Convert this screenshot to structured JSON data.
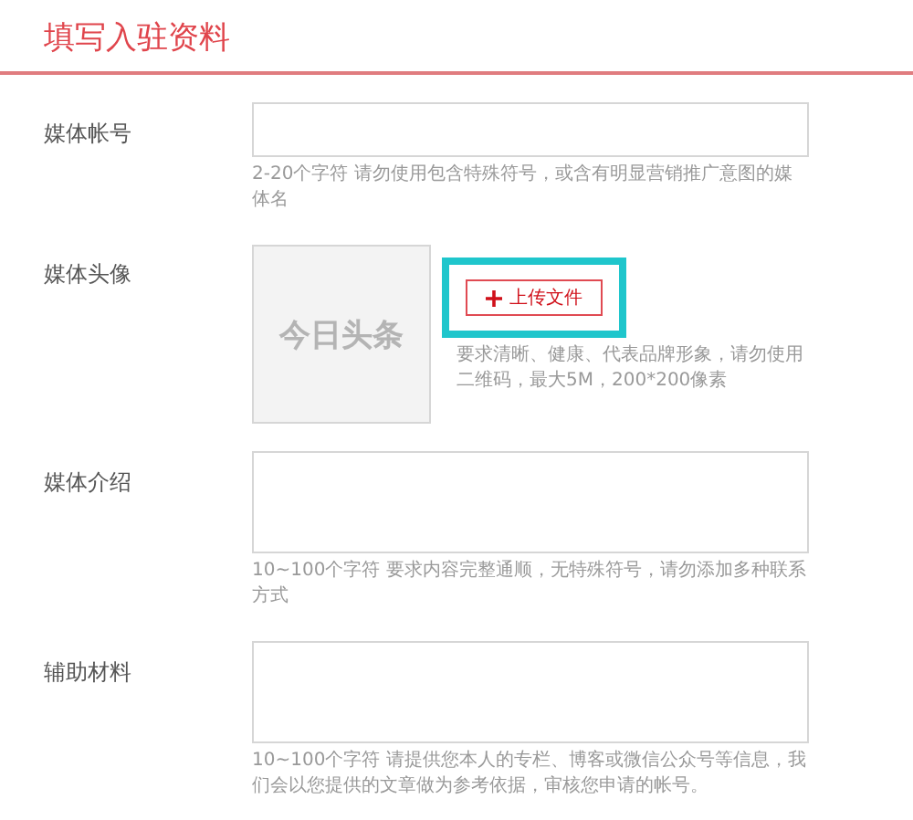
{
  "title": "填写入驻资料",
  "fields": [
    {
      "kind": "input",
      "label": "媒体帐号",
      "hint": "2-20个字符 请勿使用包含特殊符号，或含有明显营销推广意图的媒体名"
    },
    {
      "kind": "avatar",
      "label": "媒体头像",
      "logo": "今日头条",
      "upload_button": {
        "label": "上传文件",
        "highlighted": true
      },
      "hint": "要求清晰、健康、代表品牌形象，请勿使用二维码，最大5M，200*200像素"
    },
    {
      "kind": "textarea",
      "label": "媒体介绍",
      "hint": "10~100个字符 要求内容完整通顺，无特殊符号，请勿添加多种联系方式"
    },
    {
      "kind": "textarea",
      "label": "辅助材料",
      "hint": "10~100个字符  请提供您本人的专栏、博客或微信公众号等信息，我们会以您提供的文章做为参考依据，审核您申请的帐号。"
    }
  ]
}
